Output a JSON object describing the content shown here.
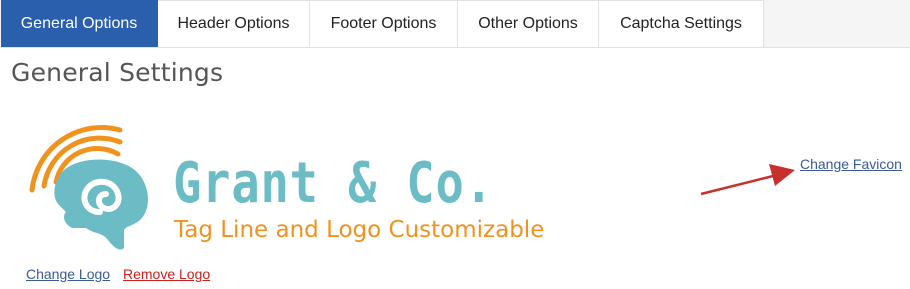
{
  "tabs": [
    {
      "label": "General Options",
      "active": true
    },
    {
      "label": "Header Options",
      "active": false
    },
    {
      "label": "Footer Options",
      "active": false
    },
    {
      "label": "Other Options",
      "active": false
    },
    {
      "label": "Captcha Settings",
      "active": false
    }
  ],
  "page_title": "General Settings",
  "logo": {
    "name": "Grant & Co.",
    "tagline": "Tag Line and Logo Customizable",
    "icon": "head-spiral-logo-icon",
    "colors": {
      "teal": "#6cbcc6",
      "orange": "#f0931e"
    }
  },
  "links": {
    "change_favicon": "Change Favicon",
    "change_logo": "Change Logo",
    "remove_logo": "Remove Logo"
  },
  "annotation": {
    "icon": "red-arrow-icon",
    "color": "#c8302c"
  },
  "colors": {
    "tab_active_bg": "#2a5fad",
    "link": "#3a5b97",
    "remove_link": "#cc1f1f"
  }
}
